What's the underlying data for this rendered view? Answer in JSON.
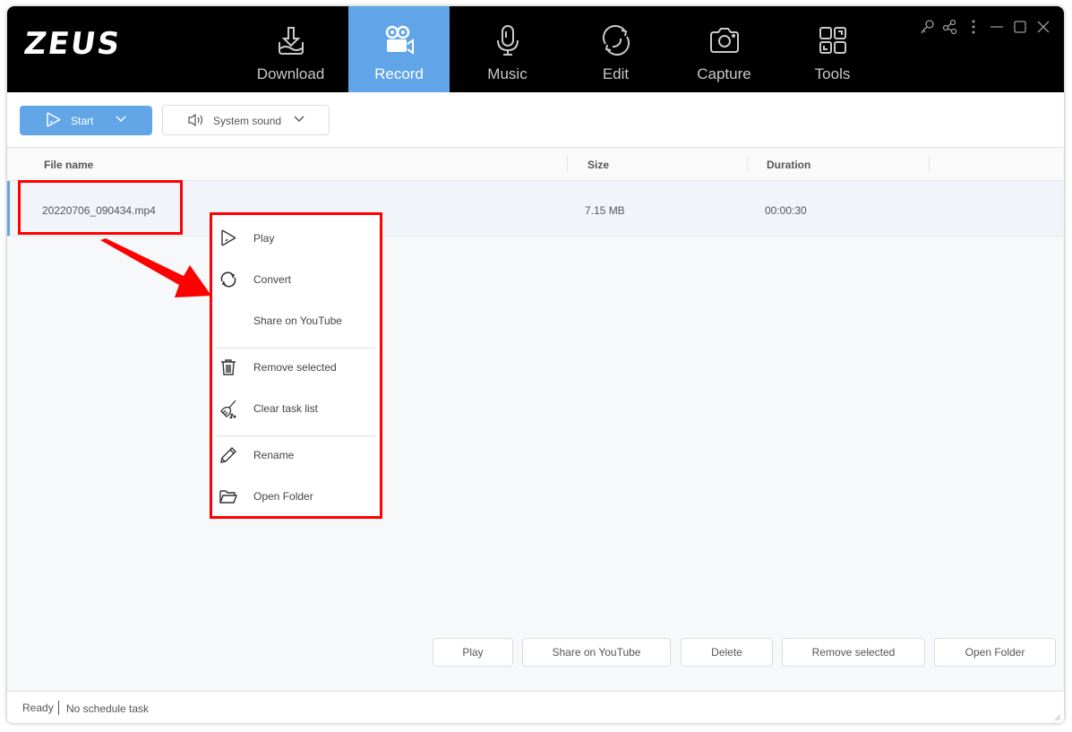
{
  "app": {
    "logo": "ZEUS",
    "accent_color": "#5fa5e8"
  },
  "nav": {
    "tabs": [
      {
        "label": "Download",
        "icon": "download-icon",
        "active": false
      },
      {
        "label": "Record",
        "icon": "video-camera-icon",
        "active": true
      },
      {
        "label": "Music",
        "icon": "microphone-icon",
        "active": false
      },
      {
        "label": "Edit",
        "icon": "refresh-icon",
        "active": false
      },
      {
        "label": "Capture",
        "icon": "camera-icon",
        "active": false
      },
      {
        "label": "Tools",
        "icon": "tools-grid-icon",
        "active": false
      }
    ]
  },
  "window_controls": [
    "key-icon",
    "share-icon",
    "more-icon",
    "minimize-icon",
    "maximize-icon",
    "close-icon"
  ],
  "toolbar": {
    "start_label": "Start",
    "sound_label": "System sound"
  },
  "table": {
    "columns": [
      "File name",
      "Size",
      "Duration"
    ],
    "rows": [
      {
        "file_name": "20220706_090434.mp4",
        "size": "7.15 MB",
        "duration": "00:00:30"
      }
    ]
  },
  "context_menu": {
    "items": [
      {
        "label": "Play",
        "icon": "play-icon"
      },
      {
        "label": "Convert",
        "icon": "convert-icon"
      },
      {
        "label": "Share on YouTube",
        "icon": ""
      },
      {
        "label": "Remove selected",
        "icon": "trash-icon"
      },
      {
        "label": "Clear task list",
        "icon": "broom-icon"
      },
      {
        "label": "Rename",
        "icon": "pencil-icon"
      },
      {
        "label": "Open Folder",
        "icon": "folder-icon"
      }
    ]
  },
  "bottom_actions": {
    "play": "Play",
    "share": "Share on YouTube",
    "delete": "Delete",
    "remove": "Remove selected",
    "open_folder": "Open Folder"
  },
  "status": {
    "state": "Ready",
    "schedule": "No schedule task"
  },
  "annotation_color": "#ff0000"
}
